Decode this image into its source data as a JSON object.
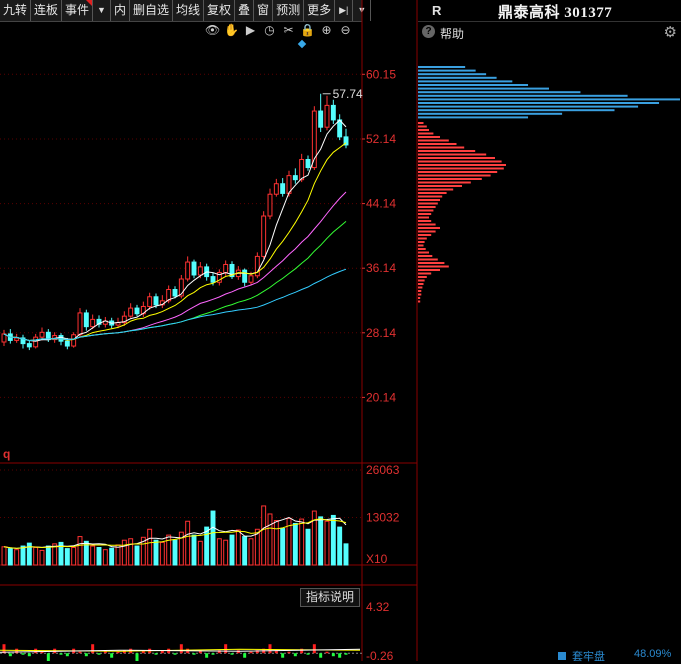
{
  "tabs": [
    {
      "label": "九转",
      "red": false
    },
    {
      "label": "连板",
      "red": false
    },
    {
      "label": "事件",
      "red": true
    },
    {
      "label": "内",
      "red": false
    },
    {
      "label": "删自选",
      "red": false
    },
    {
      "label": "均线",
      "red": false
    },
    {
      "label": "复权",
      "red": false
    },
    {
      "label": "叠",
      "red": false
    },
    {
      "label": "窗",
      "red": false
    },
    {
      "label": "预测",
      "red": false
    },
    {
      "label": "更多",
      "red": false
    }
  ],
  "right_header": {
    "r_label": "R",
    "title": "鼎泰高科 301377",
    "help_label": "帮助"
  },
  "price_axis": [
    "60.15",
    "52.14",
    "44.14",
    "36.14",
    "28.14",
    "20.14"
  ],
  "high_marker": "57.74",
  "volume_axis": {
    "top": "26063",
    "mid": "13032",
    "unit": "X10"
  },
  "indicator_axis": {
    "top": "4.32",
    "bottom": "-0.26"
  },
  "indicator_button": "指标说明",
  "panel_marker": "q",
  "bottom_strip": {
    "label": "套牢盘",
    "value": "48.09%"
  },
  "colors": {
    "up": "#ff3232",
    "down": "#54ffff",
    "axis": "#e03030",
    "grid": "#5a0000",
    "ma5": "#ffffff",
    "ma10": "#ffff00",
    "ma20": "#ff66ff",
    "ma30": "#33ff33",
    "ma60": "#33ccff"
  },
  "chart_data": {
    "type": "candlestick",
    "ylim": [
      12.14,
      64.15
    ],
    "price_ticks": [
      60.15,
      52.14,
      44.14,
      36.14,
      28.14,
      20.14
    ],
    "candles": [
      [
        27,
        28,
        26.5,
        28.5
      ],
      [
        28,
        27.2,
        26.8,
        28.6
      ],
      [
        27.2,
        27.5,
        26.9,
        28
      ],
      [
        27.5,
        26.8,
        26.2,
        27.9
      ],
      [
        26.8,
        26.4,
        26,
        27.2
      ],
      [
        26.4,
        27.6,
        26.2,
        28
      ],
      [
        27.6,
        28.2,
        27.2,
        28.8
      ],
      [
        28.2,
        27.3,
        27,
        28.6
      ],
      [
        27.3,
        27.8,
        26.9,
        28.2
      ],
      [
        27.8,
        27.1,
        26.6,
        28.1
      ],
      [
        27.1,
        26.5,
        26.1,
        27.5
      ],
      [
        26.5,
        27.9,
        26.3,
        28.2
      ],
      [
        27.9,
        30.6,
        27.6,
        31.2
      ],
      [
        30.6,
        28.9,
        28.4,
        31
      ],
      [
        28.9,
        29.8,
        28.6,
        30.4
      ],
      [
        29.8,
        29.2,
        28.8,
        30.3
      ],
      [
        29.2,
        29.6,
        28.8,
        30.1
      ],
      [
        29.6,
        29.1,
        28.7,
        30
      ],
      [
        29.1,
        29.4,
        28.7,
        30
      ],
      [
        29.4,
        30.2,
        29,
        30.8
      ],
      [
        30.2,
        31.2,
        30,
        31.8
      ],
      [
        31.2,
        30.5,
        30.2,
        31.6
      ],
      [
        30.5,
        31.4,
        30.1,
        32
      ],
      [
        31.4,
        32.6,
        31,
        33.1
      ],
      [
        32.6,
        31.6,
        31.2,
        33
      ],
      [
        31.6,
        32.1,
        31.2,
        32.8
      ],
      [
        32.1,
        33.5,
        31.8,
        34
      ],
      [
        33.5,
        32.7,
        32.4,
        33.9
      ],
      [
        32.7,
        34.8,
        32.4,
        35.3
      ],
      [
        34.8,
        36.9,
        34.5,
        37.6
      ],
      [
        36.9,
        35.3,
        34.9,
        37.2
      ],
      [
        35.3,
        36.3,
        34.9,
        36.9
      ],
      [
        36.3,
        35.1,
        34.6,
        36.7
      ],
      [
        35.1,
        34.4,
        34,
        35.6
      ],
      [
        34.4,
        35.6,
        34,
        36
      ],
      [
        35.6,
        36.6,
        35.2,
        37.1
      ],
      [
        36.6,
        35.1,
        34.8,
        37
      ],
      [
        35.1,
        35.9,
        34.7,
        36.4
      ],
      [
        35.9,
        34.4,
        33.9,
        36.1
      ],
      [
        34.4,
        35.2,
        34,
        35.7
      ],
      [
        35.2,
        37.6,
        34.9,
        38.1
      ],
      [
        37.6,
        42.6,
        37.3,
        43.2
      ],
      [
        42.6,
        45.3,
        42.2,
        46
      ],
      [
        45.3,
        46.6,
        45,
        47.2
      ],
      [
        46.6,
        45.4,
        45,
        47.3
      ],
      [
        45.4,
        47.6,
        45,
        48.2
      ],
      [
        47.6,
        47.1,
        46.6,
        48.5
      ],
      [
        47.1,
        49.6,
        46.8,
        50.3
      ],
      [
        49.6,
        48.6,
        48.2,
        50.1
      ],
      [
        48.6,
        55.6,
        48.3,
        56.2
      ],
      [
        55.6,
        53.6,
        53,
        57.74
      ],
      [
        53.6,
        56.3,
        53.2,
        57.5
      ],
      [
        56.3,
        54.5,
        54,
        57
      ],
      [
        54.5,
        52.4,
        52,
        55.2
      ],
      [
        52.4,
        51.4,
        51,
        53.4
      ]
    ],
    "volume_ylim": [
      0,
      26063
    ],
    "volume_ticks": [
      26063,
      13032
    ],
    "volumes": [
      5000,
      4500,
      4200,
      5200,
      6000,
      4800,
      4000,
      5200,
      5800,
      6200,
      4500,
      4800,
      7800,
      6500,
      5200,
      4800,
      4200,
      4600,
      5500,
      6800,
      7200,
      5200,
      7600,
      9800,
      6800,
      6200,
      8200,
      6800,
      9000,
      12000,
      8200,
      6500,
      10400,
      14800,
      7200,
      6800,
      8200,
      9600,
      7800,
      7200,
      9800,
      16200,
      14000,
      12200,
      10000,
      12800,
      11400,
      12600,
      9800,
      14800,
      13200,
      12000,
      13600,
      10400,
      5800
    ],
    "volume_up": [
      true,
      false,
      true,
      false,
      false,
      true,
      true,
      false,
      true,
      false,
      false,
      true,
      true,
      false,
      true,
      false,
      true,
      false,
      true,
      true,
      true,
      false,
      true,
      true,
      false,
      true,
      true,
      false,
      true,
      true,
      false,
      true,
      false,
      false,
      true,
      true,
      false,
      true,
      false,
      true,
      true,
      true,
      true,
      true,
      false,
      true,
      false,
      true,
      false,
      true,
      false,
      true,
      false,
      false,
      false
    ],
    "ma5_last": 52.9,
    "indicator_ylim": [
      -0.26,
      4.32
    ],
    "indicator_ticks": [
      4.32,
      -0.26
    ],
    "profile_levels": "depth histogram of holding cost distribution",
    "profile_top": [
      0.18,
      0.22,
      0.26,
      0.3,
      0.36,
      0.42,
      0.5,
      0.62,
      0.8,
      1.0,
      0.92,
      0.84,
      0.75,
      0.55,
      0.42
    ],
    "profile_bottom": [
      0.05,
      0.08,
      0.1,
      0.14,
      0.2,
      0.28,
      0.35,
      0.42,
      0.52,
      0.62,
      0.7,
      0.76,
      0.8,
      0.78,
      0.72,
      0.66,
      0.58,
      0.48,
      0.4,
      0.32,
      0.26,
      0.22,
      0.2,
      0.18,
      0.16,
      0.14,
      0.12,
      0.1,
      0.12,
      0.16,
      0.2,
      0.16,
      0.12,
      0.08,
      0.06,
      0.05,
      0.07,
      0.1,
      0.13,
      0.18,
      0.24,
      0.28,
      0.2,
      0.12,
      0.08,
      0.06,
      0.05,
      0.04,
      0.03,
      0.03,
      0.02,
      0.02
    ]
  }
}
